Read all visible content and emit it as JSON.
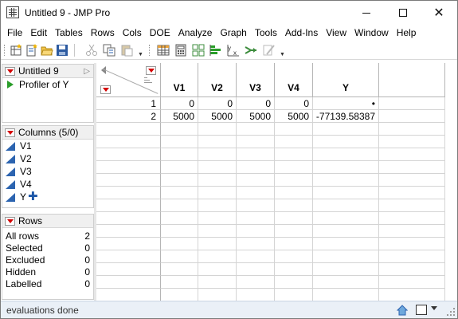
{
  "window": {
    "title": "Untitled 9 - JMP Pro"
  },
  "menu": [
    "File",
    "Edit",
    "Tables",
    "Rows",
    "Cols",
    "DOE",
    "Analyze",
    "Graph",
    "Tools",
    "Add-Ins",
    "View",
    "Window",
    "Help"
  ],
  "toolbar": {
    "icons": [
      "new-data-table-icon",
      "new-script-icon",
      "open-icon",
      "save-icon",
      "cut-icon",
      "copy-icon",
      "paste-icon",
      "data-table-icon",
      "calculator-icon",
      "table-layout-icon",
      "distribution-icon",
      "fit-y-by-x-icon",
      "fit-model-icon",
      "edit-icon"
    ]
  },
  "table_panel": {
    "title": "Untitled 9",
    "scripts": [
      "Profiler of Y"
    ]
  },
  "columns_panel": {
    "title": "Columns (5/0)",
    "columns": [
      "V1",
      "V2",
      "V3",
      "V4",
      "Y"
    ]
  },
  "rows_panel": {
    "title": "Rows",
    "stats": [
      {
        "label": "All rows",
        "value": "2"
      },
      {
        "label": "Selected",
        "value": "0"
      },
      {
        "label": "Excluded",
        "value": "0"
      },
      {
        "label": "Hidden",
        "value": "0"
      },
      {
        "label": "Labelled",
        "value": "0"
      }
    ]
  },
  "grid": {
    "headers": [
      "V1",
      "V2",
      "V3",
      "V4",
      "Y"
    ],
    "rows": [
      {
        "num": "1",
        "cells": [
          "0",
          "0",
          "0",
          "0",
          "•"
        ]
      },
      {
        "num": "2",
        "cells": [
          "5000",
          "5000",
          "5000",
          "5000",
          "-77139.58387"
        ]
      }
    ],
    "empty_rows": 14
  },
  "status": {
    "text": "evaluations done"
  },
  "colors": {
    "accent_blue": "#2c64b0",
    "dropdown_red": "#d40000",
    "script_green": "#2a9d2a",
    "status_bg": "#eaf0f7"
  }
}
